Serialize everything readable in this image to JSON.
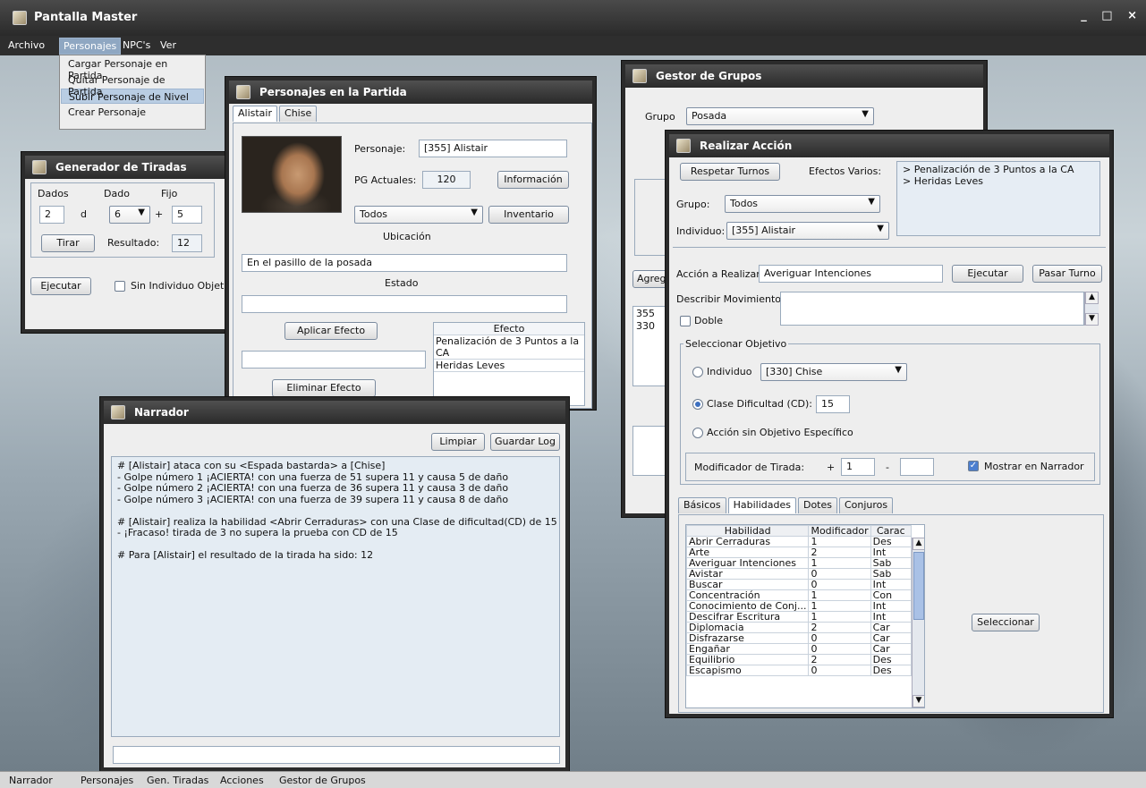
{
  "app": {
    "title": "Pantalla Master",
    "window_controls": "_ □ ×"
  },
  "menubar": [
    "Archivo",
    "Personajes",
    "NPC's",
    "Ver"
  ],
  "personajes_menu": [
    "Cargar Personaje en Partida",
    "Quitar Personaje de Partida",
    "Subir Personaje de Nivel",
    "Crear Personaje"
  ],
  "generador": {
    "title": "Generador de Tiradas",
    "dados_label": "Dados",
    "dado_label": "Dado",
    "fijo_label": "Fijo",
    "dados_value": "2",
    "d_label": "d",
    "dado_value": "6",
    "plus": "+",
    "fijo_value": "5",
    "tirar": "Tirar",
    "resultado_label": "Resultado:",
    "resultado_value": "12",
    "ejecutar": "Ejecutar",
    "sin_individuo": "Sin Individuo Objetivo"
  },
  "personajes": {
    "title": "Personajes en la Partida",
    "tabs": [
      "Alistair",
      "Chise"
    ],
    "personaje_label": "Personaje:",
    "personaje_value": "[355] Alistair",
    "pg_label": "PG Actuales:",
    "pg_value": "120",
    "informacion": "Información",
    "todos": "Todos",
    "inventario": "Inventario",
    "ubicacion_label": "Ubicación",
    "ubicacion_value": "En el pasillo de la posada",
    "estado_label": "Estado",
    "aplicar_efecto": "Aplicar Efecto",
    "eliminar_efecto": "Eliminar Efecto",
    "efecto_header": "Efecto",
    "efectos": [
      "Penalización de 3 Puntos a la CA",
      "Heridas Leves"
    ]
  },
  "gestor": {
    "title": "Gestor de Grupos",
    "grupo_label": "Grupo",
    "grupo_value": "Posada",
    "agregar_partial": "Agreg",
    "ids": [
      "355",
      "330"
    ]
  },
  "realizar": {
    "title": "Realizar Acción",
    "respetar_turnos": "Respetar Turnos",
    "efectos_varios_label": "Efectos Varios:",
    "efectos_varios": [
      "> Penalización de 3 Puntos a la CA",
      "> Heridas Leves"
    ],
    "grupo_label": "Grupo:",
    "grupo_value": "Todos",
    "individuo_label": "Individuo:",
    "individuo_value": "[355] Alistair",
    "accion_label": "Acción a Realizar:",
    "accion_value": "Averiguar Intenciones",
    "ejecutar": "Ejecutar",
    "pasar_turno": "Pasar Turno",
    "describir_label": "Describir Movimientos:",
    "doble": "Doble",
    "seleccionar_objetivo": "Seleccionar Objetivo",
    "opt_individuo": "Individuo",
    "objetivo_value": "[330] Chise",
    "opt_cd": "Clase Dificultad (CD):",
    "cd_value": "15",
    "opt_sin": "Acción sin Objetivo Específico",
    "modificador_label": "Modificador de Tirada:",
    "plus": "+",
    "mod_value": "1",
    "minus": "-",
    "mostrar_narrador": "Mostrar en Narrador",
    "tabs": [
      "Básicos",
      "Habilidades",
      "Dotes",
      "Conjuros"
    ],
    "table_headers": [
      "Habilidad",
      "Modificador",
      "Carac"
    ],
    "rows": [
      [
        "Abrir Cerraduras",
        "1",
        "Des"
      ],
      [
        "Arte",
        "2",
        "Int"
      ],
      [
        "Averiguar Intenciones",
        "1",
        "Sab"
      ],
      [
        "Avistar",
        "0",
        "Sab"
      ],
      [
        "Buscar",
        "0",
        "Int"
      ],
      [
        "Concentración",
        "1",
        "Con"
      ],
      [
        "Conocimiento de Conj...",
        "1",
        "Int"
      ],
      [
        "Descifrar Escritura",
        "1",
        "Int"
      ],
      [
        "Diplomacia",
        "2",
        "Car"
      ],
      [
        "Disfrazarse",
        "0",
        "Car"
      ],
      [
        "Engañar",
        "0",
        "Car"
      ],
      [
        "Equilibrio",
        "2",
        "Des"
      ],
      [
        "Escapismo",
        "0",
        "Des"
      ]
    ],
    "seleccionar": "Seleccionar"
  },
  "narrador": {
    "title": "Narrador",
    "limpiar": "Limpiar",
    "guardar_log": "Guardar Log",
    "log": [
      "# [Alistair] ataca con su <Espada bastarda> a [Chise]",
      "- Golpe número 1 ¡ACIERTA! con una fuerza de 51 supera 11 y causa 5 de daño",
      "- Golpe número 2 ¡ACIERTA! con una fuerza de 36 supera 11 y causa 3 de daño",
      "- Golpe número 3 ¡ACIERTA! con una fuerza de 39 supera 11 y causa 8 de daño",
      "",
      "# [Alistair] realiza la habilidad <Abrir Cerraduras> con una Clase de dificultad(CD) de 15",
      "- ¡Fracaso! tirada de 3 no supera la prueba con CD de 15",
      "",
      "# Para [Alistair] el resultado de la tirada ha sido: 12"
    ]
  },
  "taskbar": [
    "Narrador",
    "Personajes",
    "Gen. Tiradas",
    "Acciones",
    "Gestor de Grupos"
  ]
}
